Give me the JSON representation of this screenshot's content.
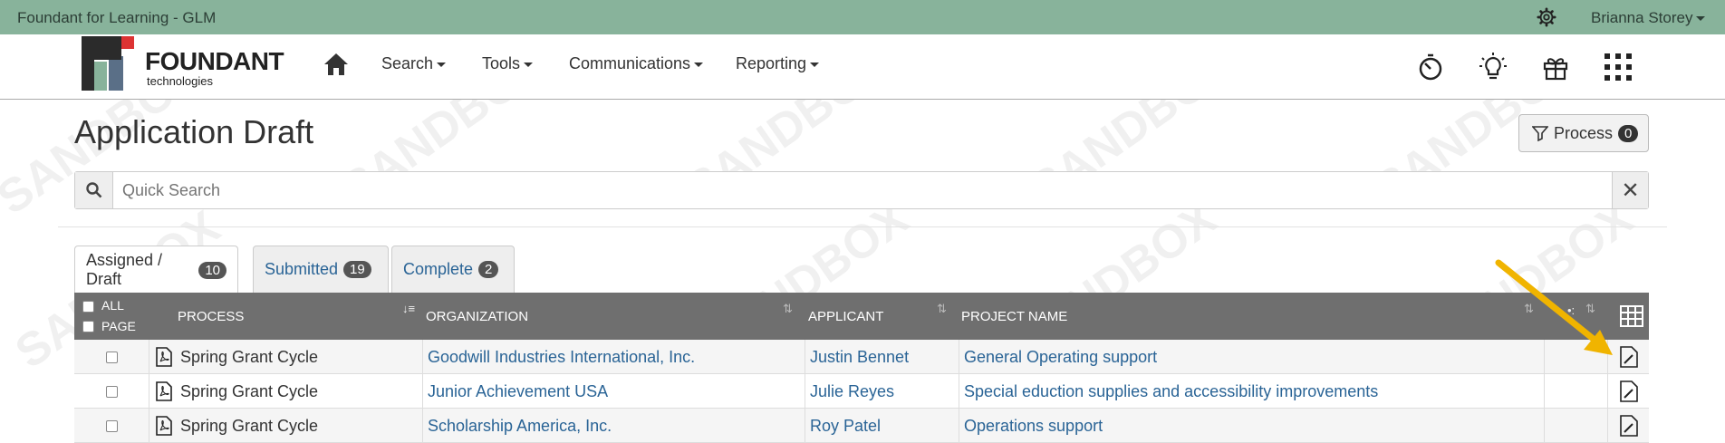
{
  "topbar": {
    "title": "Foundant for Learning - GLM",
    "user": "Brianna Storey"
  },
  "logo": {
    "name": "FOUNDANT",
    "sub": "technologies"
  },
  "nav": {
    "items": [
      "Search",
      "Tools",
      "Communications",
      "Reporting"
    ]
  },
  "watermark": "SANDBOX",
  "page": {
    "title": "Application Draft",
    "process_label": "Process",
    "process_count": "0"
  },
  "search": {
    "placeholder": "Quick Search"
  },
  "tabs": [
    {
      "label": "Assigned / Draft",
      "count": "10"
    },
    {
      "label": "Submitted",
      "count": "19"
    },
    {
      "label": "Complete",
      "count": "2"
    }
  ],
  "table": {
    "select_all": "ALL",
    "select_page": "PAGE",
    "columns": [
      "PROCESS",
      "ORGANIZATION",
      "APPLICANT",
      "PROJECT NAME"
    ],
    "rows": [
      {
        "process": "Spring Grant Cycle",
        "organization": "Goodwill Industries International, Inc.",
        "applicant": "Justin Bennet",
        "project": "General Operating support"
      },
      {
        "process": "Spring Grant Cycle",
        "organization": "Junior Achievement USA",
        "applicant": "Julie Reyes",
        "project": "Special eduction supplies and accessibility improvements"
      },
      {
        "process": "Spring Grant Cycle",
        "organization": "Scholarship America, Inc.",
        "applicant": "Roy Patel",
        "project": "Operations support"
      }
    ]
  },
  "colors": {
    "topbar": "#88b39b",
    "header": "#6f6f6f",
    "link": "#2a6496",
    "arrow": "#f0b400"
  }
}
